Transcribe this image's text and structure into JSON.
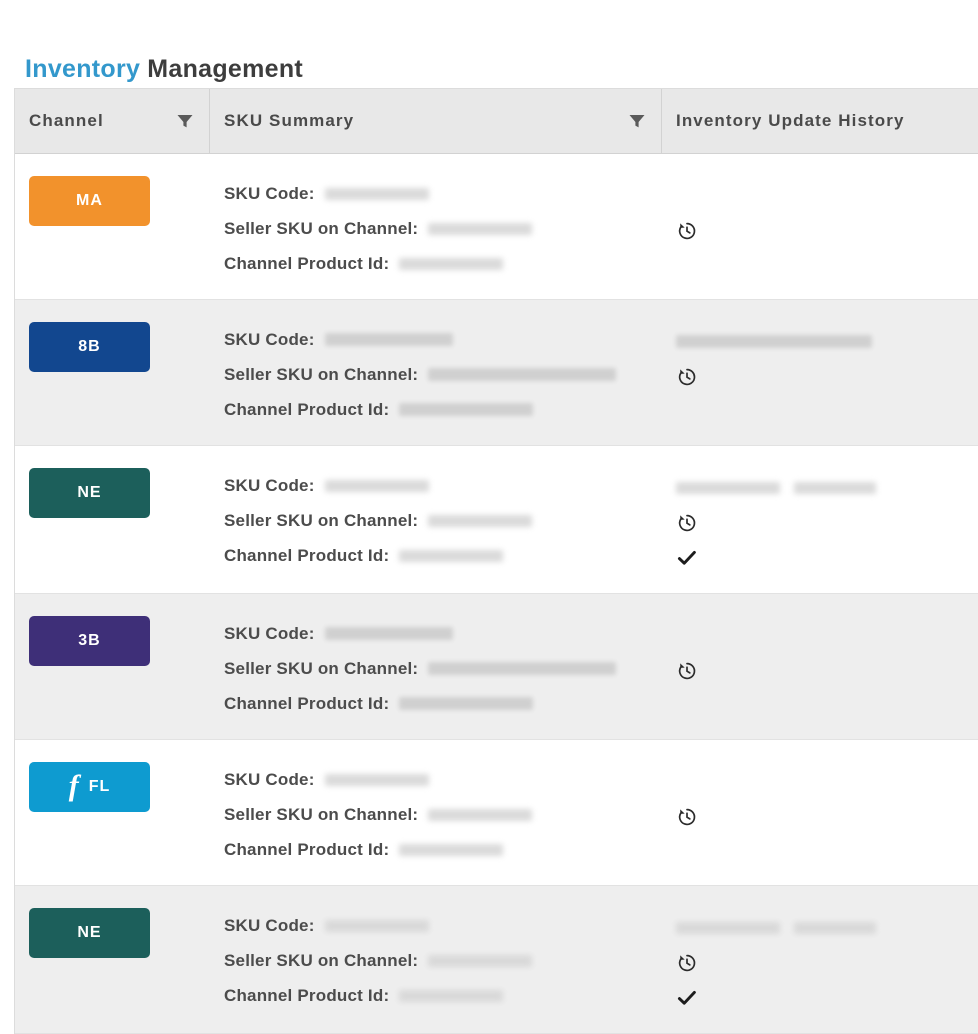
{
  "page": {
    "title_accent": "Inventory",
    "title_rest": "Management"
  },
  "table": {
    "columns": [
      {
        "label": "Channel",
        "filter_icon": "funnel-icon",
        "has_filter": true
      },
      {
        "label": "SKU Summary",
        "filter_icon": "funnel-icon",
        "has_filter": true
      },
      {
        "label": "Inventory Update History",
        "has_filter": false
      }
    ],
    "sku_labels": {
      "code": "SKU Code:",
      "seller": "Seller SKU on Channel:",
      "product": "Channel Product Id:"
    },
    "icons": {
      "history": "history-icon",
      "check": "check-icon"
    },
    "rows": [
      {
        "channel": {
          "code": "MA",
          "color": "#F2922C",
          "has_logo": false
        },
        "redaction": "short",
        "history": {
          "has_header_value": false,
          "has_history_icon": true,
          "has_check": false
        }
      },
      {
        "channel": {
          "code": "8B",
          "color": "#12478F",
          "has_logo": false
        },
        "redaction": "long",
        "history": {
          "has_header_value": true,
          "has_history_icon": true,
          "has_check": false
        }
      },
      {
        "channel": {
          "code": "NE",
          "color": "#1C5F5B",
          "has_logo": false
        },
        "redaction": "short",
        "history": {
          "has_header_value": true,
          "has_history_icon": true,
          "has_check": true
        }
      },
      {
        "channel": {
          "code": "3B",
          "color": "#3E2F78",
          "has_logo": false
        },
        "redaction": "long",
        "history": {
          "has_header_value": false,
          "has_history_icon": true,
          "has_check": false
        }
      },
      {
        "channel": {
          "code": "FL",
          "color": "#0E9BD0",
          "has_logo": true,
          "logo_glyph": "f"
        },
        "redaction": "short",
        "history": {
          "has_header_value": false,
          "has_history_icon": true,
          "has_check": false
        }
      },
      {
        "channel": {
          "code": "NE",
          "color": "#1C5F5B",
          "has_logo": false
        },
        "redaction": "short",
        "history": {
          "has_header_value": true,
          "has_history_icon": true,
          "has_check": true
        }
      }
    ]
  }
}
